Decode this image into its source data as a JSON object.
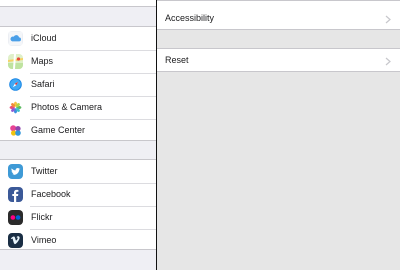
{
  "sidebar": {
    "apps": [
      {
        "id": "icloud",
        "label": "iCloud",
        "icon": "icloud-icon"
      },
      {
        "id": "maps",
        "label": "Maps",
        "icon": "maps-icon"
      },
      {
        "id": "safari",
        "label": "Safari",
        "icon": "safari-icon"
      },
      {
        "id": "photos",
        "label": "Photos & Camera",
        "icon": "photos-camera-icon"
      },
      {
        "id": "game-center",
        "label": "Game Center",
        "icon": "game-center-icon"
      }
    ],
    "social": [
      {
        "id": "twitter",
        "label": "Twitter",
        "icon": "twitter-icon"
      },
      {
        "id": "facebook",
        "label": "Facebook",
        "icon": "facebook-icon"
      },
      {
        "id": "flickr",
        "label": "Flickr",
        "icon": "flickr-icon"
      },
      {
        "id": "vimeo",
        "label": "Vimeo",
        "icon": "vimeo-icon"
      }
    ]
  },
  "detail": {
    "accessibility": {
      "label": "Accessibility",
      "icon": "chevron-right-icon"
    },
    "reset": {
      "label": "Reset",
      "icon": "chevron-right-icon"
    }
  },
  "colors": {
    "background": "#efeff4",
    "detail_background": "#e6e6e6",
    "separator": "#c8c7cc",
    "text": "#1c1c1e",
    "chevron": "#c7c7cc"
  }
}
